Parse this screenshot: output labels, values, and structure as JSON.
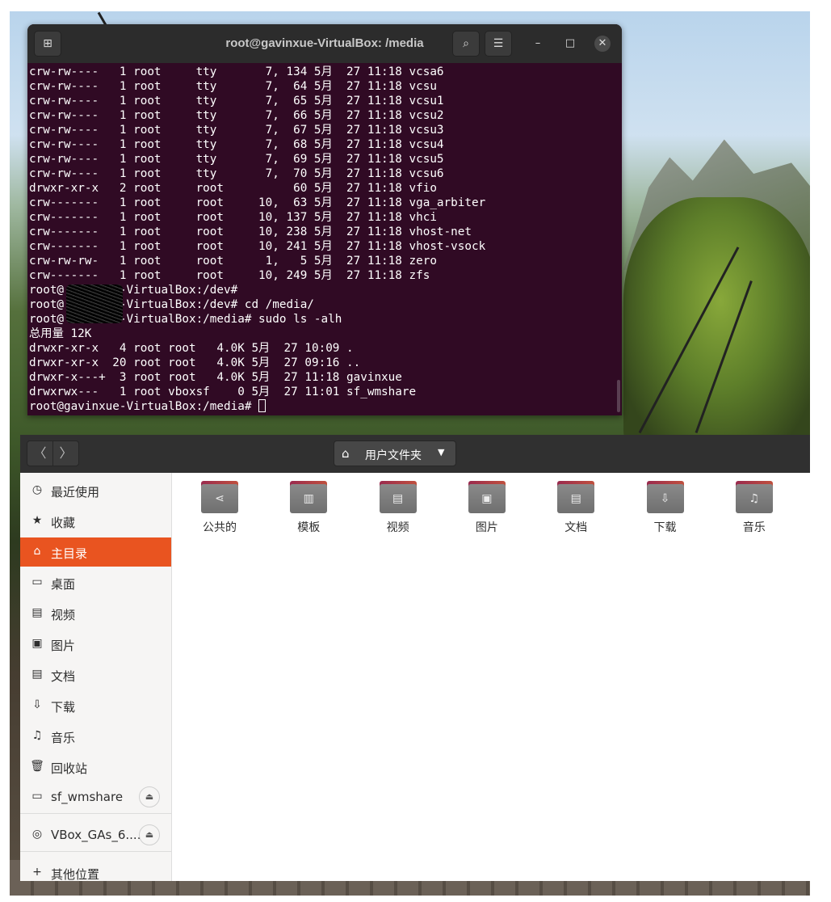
{
  "terminal": {
    "title": "root@gavinxue-VirtualBox: /media",
    "lines": [
      "crw-rw----   1 root     tty       7, 134 5月  27 11:18 vcsa6",
      "crw-rw----   1 root     tty       7,  64 5月  27 11:18 vcsu",
      "crw-rw----   1 root     tty       7,  65 5月  27 11:18 vcsu1",
      "crw-rw----   1 root     tty       7,  66 5月  27 11:18 vcsu2",
      "crw-rw----   1 root     tty       7,  67 5月  27 11:18 vcsu3",
      "crw-rw----   1 root     tty       7,  68 5月  27 11:18 vcsu4",
      "crw-rw----   1 root     tty       7,  69 5月  27 11:18 vcsu5",
      "crw-rw----   1 root     tty       7,  70 5月  27 11:18 vcsu6",
      "drwxr-xr-x   2 root     root          60 5月  27 11:18 vfio",
      "crw-------   1 root     root     10,  63 5月  27 11:18 vga_arbiter",
      "crw-------   1 root     root     10, 137 5月  27 11:18 vhci",
      "crw-------   1 root     root     10, 238 5月  27 11:18 vhost-net",
      "crw-------   1 root     root     10, 241 5月  27 11:18 vhost-vsock",
      "crw-rw-rw-   1 root     root      1,   5 5月  27 11:18 zero",
      "crw-------   1 root     root     10, 249 5月  27 11:18 zfs",
      "root@        -VirtualBox:/dev#",
      "root@        -VirtualBox:/dev# cd /media/",
      "root@        -VirtualBox:/media# sudo ls -alh",
      "总用量 12K",
      "drwxr-xr-x   4 root root   4.0K 5月  27 10:09 .",
      "drwxr-xr-x  20 root root   4.0K 5月  27 09:16 ..",
      "drwxr-x---+  3 root root   4.0K 5月  27 11:18 gavinxue",
      "drwxrwx---   1 root vboxsf    0 5月  27 11:01 sf_wmshare"
    ],
    "prompt": "root@gavinxue-VirtualBox:/media# "
  },
  "files": {
    "back_glyph": "〈",
    "forward_glyph": "〉",
    "path_label": "用户文件夹",
    "sidebar": [
      {
        "icon": "clock-icon",
        "glyph": "◷",
        "label": "最近使用"
      },
      {
        "icon": "star-icon",
        "glyph": "★",
        "label": "收藏"
      },
      {
        "icon": "home-icon",
        "glyph": "⌂",
        "label": "主目录"
      },
      {
        "icon": "desktop-icon",
        "glyph": "▭",
        "label": "桌面"
      },
      {
        "icon": "video-icon",
        "glyph": "▤",
        "label": "视频"
      },
      {
        "icon": "picture-icon",
        "glyph": "▣",
        "label": "图片"
      },
      {
        "icon": "document-icon",
        "glyph": "▤",
        "label": "文档"
      },
      {
        "icon": "download-icon",
        "glyph": "⇩",
        "label": "下载"
      },
      {
        "icon": "music-icon",
        "glyph": "♫",
        "label": "音乐"
      },
      {
        "icon": "trash-icon",
        "glyph": "🗑",
        "label": "回收站"
      },
      {
        "icon": "drive-icon",
        "glyph": "▭",
        "label": "sf_wmshare"
      },
      {
        "icon": "disc-icon",
        "glyph": "◎",
        "label": "VBox_GAs_6...."
      },
      {
        "icon": "plus-icon",
        "glyph": "+",
        "label": "其他位置"
      }
    ],
    "folders": [
      {
        "icon": "share-icon",
        "glyph": "⋖",
        "label": "公共的"
      },
      {
        "icon": "template-icon",
        "glyph": "▥",
        "label": "模板"
      },
      {
        "icon": "video-icon",
        "glyph": "▤",
        "label": "视频"
      },
      {
        "icon": "picture-icon",
        "glyph": "▣",
        "label": "图片"
      },
      {
        "icon": "document-icon",
        "glyph": "▤",
        "label": "文档"
      },
      {
        "icon": "download-icon",
        "glyph": "⇩",
        "label": "下载"
      },
      {
        "icon": "music-icon",
        "glyph": "♫",
        "label": "音乐"
      }
    ],
    "active_index": 2
  },
  "colors": {
    "terminal_bg": "#300a24",
    "accent": "#e95420",
    "titlebar": "#2c2c2c"
  }
}
